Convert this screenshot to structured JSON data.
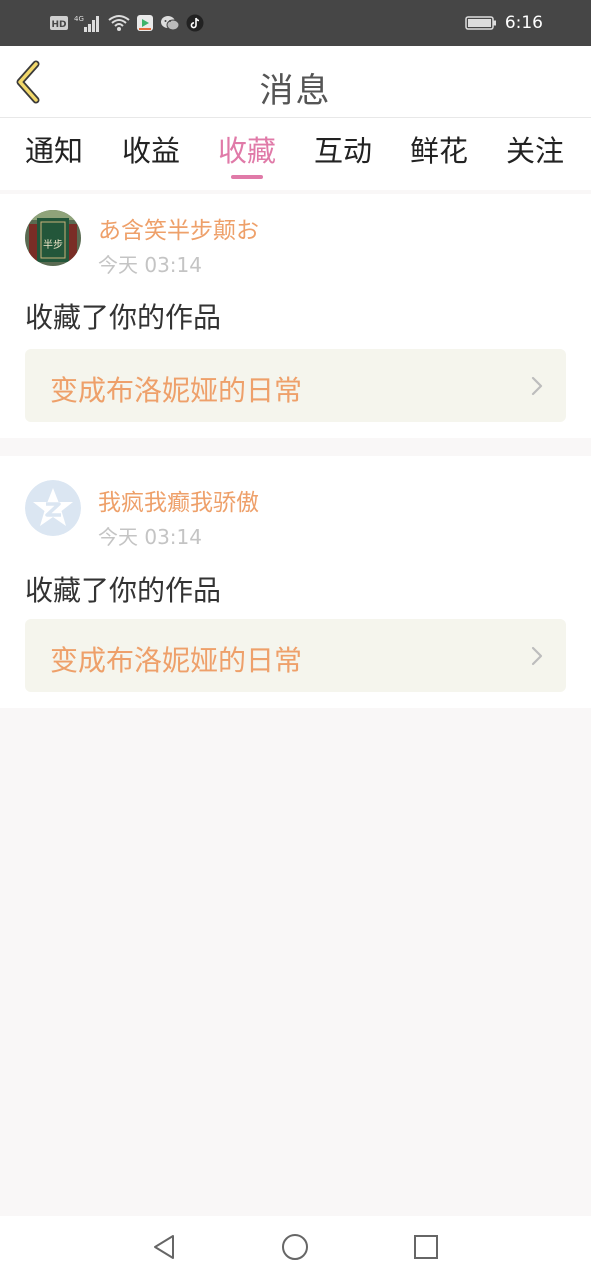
{
  "status_bar": {
    "time": "6:16",
    "icons": [
      "hd-icon",
      "4g-signal-icon",
      "wifi-icon",
      "video-app-icon",
      "wechat-icon",
      "tiktok-icon",
      "battery-icon"
    ],
    "hd_text": "HD",
    "network_text": "4G"
  },
  "header": {
    "title": "消息",
    "back_icon": "chevron-left-icon"
  },
  "tabs": [
    {
      "label": "通知",
      "active": false
    },
    {
      "label": "收益",
      "active": false
    },
    {
      "label": "收藏",
      "active": true
    },
    {
      "label": "互动",
      "active": false
    },
    {
      "label": "鲜花",
      "active": false
    },
    {
      "label": "关注",
      "active": false
    }
  ],
  "colors": {
    "accent_pink": "#e07aa8",
    "username_orange": "#eea06a",
    "link_bg": "#f5f5ed",
    "status_bar_bg": "#464646"
  },
  "messages": [
    {
      "username": "あ含笑半步颠お",
      "time": "今天 03:14",
      "action": "收藏了你的作品",
      "work_title": "变成布洛妮娅的日常",
      "avatar_text": "半步"
    },
    {
      "username": "我疯我癫我骄傲",
      "time": "今天 03:14",
      "action": "收藏了你的作品",
      "work_title": "变成布洛妮娅的日常",
      "avatar_icon": "qq-zone-star-icon"
    }
  ],
  "nav_bar": {
    "icons": [
      "back-triangle-icon",
      "home-circle-icon",
      "recents-square-icon"
    ]
  }
}
